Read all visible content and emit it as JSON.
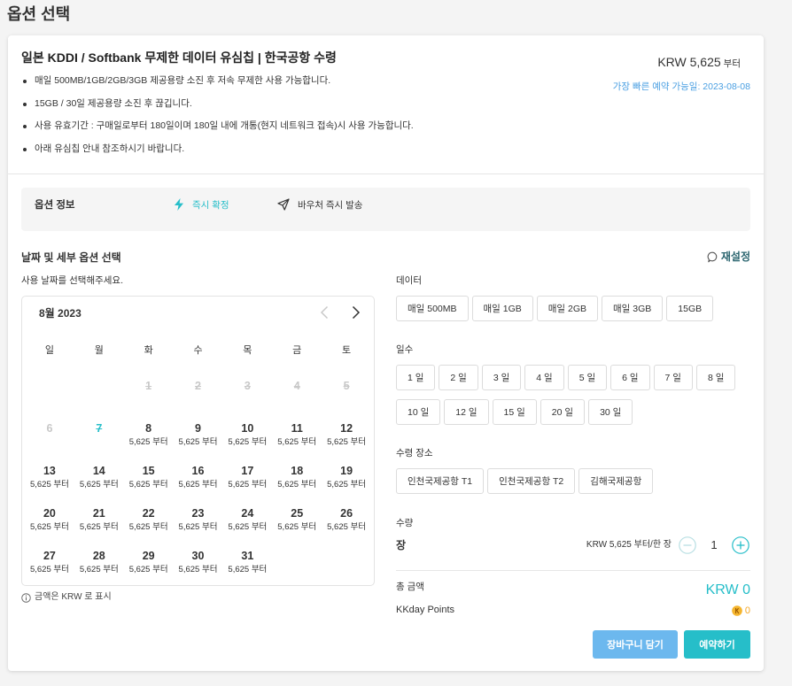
{
  "page": {
    "title": "옵션 선택"
  },
  "product": {
    "title": "일본 KDDI / Softbank 무제한 데이터 유심칩 | 한국공항 수령",
    "bullets": [
      "매일 500MB/1GB/2GB/3GB 제공용량 소진 후 저속 무제한 사용 가능합니다.",
      "15GB / 30일 제공용량 소진 후 끊깁니다.",
      "사용 유효기간 : 구매일로부터 180일이며 180일 내에 개통(현지 네트워크 접속)시 사용 가능합니다.",
      "아래 유심칩 안내 참조하시기 바랍니다."
    ],
    "price": "KRW 5,625",
    "price_suffix": "부터",
    "earliest_available": "가장 빠른 예약 가능일: 2023-08-08"
  },
  "option_info": {
    "label": "옵션 정보",
    "features": [
      {
        "icon": "lightning-icon",
        "label": "즉시 확정"
      },
      {
        "icon": "paper-plane-icon",
        "label": "바우처 즉시 발송"
      }
    ]
  },
  "selection": {
    "title": "날짜 및 세부 옵션 선택",
    "reset_label": "재설정",
    "reset_icon": "reset-icon",
    "date_prompt": "사용 날짜를 선택해주세요.",
    "currency_note": "금액은 KRW 로 표시"
  },
  "calendar": {
    "month_label": "8월 2023",
    "weekdays": [
      "일",
      "월",
      "화",
      "수",
      "목",
      "금",
      "토"
    ],
    "weeks": [
      [
        null,
        null,
        {
          "day": "1",
          "state": "past"
        },
        {
          "day": "2",
          "state": "past"
        },
        {
          "day": "3",
          "state": "past"
        },
        {
          "day": "4",
          "state": "past"
        },
        {
          "day": "5",
          "state": "past"
        }
      ],
      [
        {
          "day": "6",
          "state": "disabled"
        },
        {
          "day": "7",
          "state": "today"
        },
        {
          "day": "8",
          "price": "5,625 부터",
          "state": "available"
        },
        {
          "day": "9",
          "price": "5,625 부터",
          "state": "available"
        },
        {
          "day": "10",
          "price": "5,625 부터",
          "state": "available"
        },
        {
          "day": "11",
          "price": "5,625 부터",
          "state": "available"
        },
        {
          "day": "12",
          "price": "5,625 부터",
          "state": "available"
        }
      ],
      [
        {
          "day": "13",
          "price": "5,625 부터",
          "state": "available"
        },
        {
          "day": "14",
          "price": "5,625 부터",
          "state": "available"
        },
        {
          "day": "15",
          "price": "5,625 부터",
          "state": "available"
        },
        {
          "day": "16",
          "price": "5,625 부터",
          "state": "available"
        },
        {
          "day": "17",
          "price": "5,625 부터",
          "state": "available"
        },
        {
          "day": "18",
          "price": "5,625 부터",
          "state": "available"
        },
        {
          "day": "19",
          "price": "5,625 부터",
          "state": "available"
        }
      ],
      [
        {
          "day": "20",
          "price": "5,625 부터",
          "state": "available"
        },
        {
          "day": "21",
          "price": "5,625 부터",
          "state": "available"
        },
        {
          "day": "22",
          "price": "5,625 부터",
          "state": "available"
        },
        {
          "day": "23",
          "price": "5,625 부터",
          "state": "available"
        },
        {
          "day": "24",
          "price": "5,625 부터",
          "state": "available"
        },
        {
          "day": "25",
          "price": "5,625 부터",
          "state": "available"
        },
        {
          "day": "26",
          "price": "5,625 부터",
          "state": "available"
        }
      ],
      [
        {
          "day": "27",
          "price": "5,625 부터",
          "state": "available"
        },
        {
          "day": "28",
          "price": "5,625 부터",
          "state": "available"
        },
        {
          "day": "29",
          "price": "5,625 부터",
          "state": "available"
        },
        {
          "day": "30",
          "price": "5,625 부터",
          "state": "available"
        },
        {
          "day": "31",
          "price": "5,625 부터",
          "state": "available"
        },
        null,
        null
      ]
    ]
  },
  "options": {
    "data": {
      "label": "데이터",
      "choices": [
        "매일 500MB",
        "매일 1GB",
        "매일 2GB",
        "매일 3GB",
        "15GB"
      ]
    },
    "days": {
      "label": "일수",
      "choices": [
        "1 일",
        "2 일",
        "3 일",
        "4 일",
        "5 일",
        "6 일",
        "7 일",
        "8 일",
        "10 일",
        "12 일",
        "15 일",
        "20 일",
        "30 일"
      ]
    },
    "pickup": {
      "label": "수령 장소",
      "choices": [
        "인천국제공항 T1",
        "인천국제공항 T2",
        "김해국제공항"
      ]
    }
  },
  "quantity": {
    "label": "수량",
    "unit_label": "장",
    "unit_price": "KRW 5,625 부터/한 장",
    "value": "1"
  },
  "summary": {
    "total_label": "총 금액",
    "total_value": "KRW 0",
    "points_label": "KKday Points",
    "points_value": "0"
  },
  "actions": {
    "add_to_cart": "장바구니 담기",
    "book": "예약하기"
  },
  "colors": {
    "accent": "#26bec9",
    "date_blue": "#4a9fe2",
    "cart_button": "#6cb8ee",
    "points": "#f5a623",
    "disabled_date": "#c8c8c8"
  }
}
